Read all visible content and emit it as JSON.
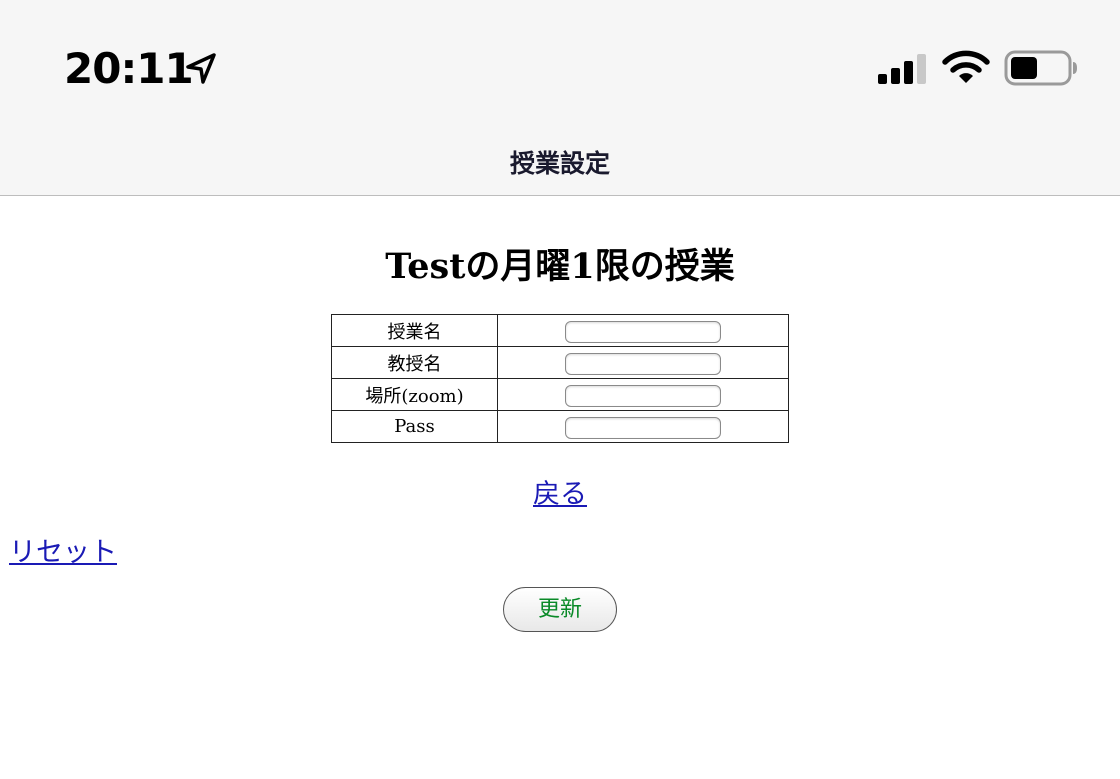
{
  "status_bar": {
    "time": "20:11",
    "icons": [
      "location-arrow-icon",
      "cellular-signal-icon",
      "wifi-icon",
      "battery-icon"
    ]
  },
  "nav": {
    "title": "授業設定"
  },
  "page": {
    "heading": "Testの月曜1限の授業"
  },
  "form": {
    "rows": [
      {
        "label": "授業名",
        "value": ""
      },
      {
        "label": "教授名",
        "value": ""
      },
      {
        "label": "場所(zoom)",
        "value": ""
      },
      {
        "label": "Pass",
        "value": ""
      }
    ]
  },
  "links": {
    "back": "戻る",
    "reset": "リセット"
  },
  "buttons": {
    "update": "更新"
  },
  "colors": {
    "link": "#1a1ab5",
    "update_text": "#0a8a28",
    "bar_background": "#f6f6f6"
  }
}
